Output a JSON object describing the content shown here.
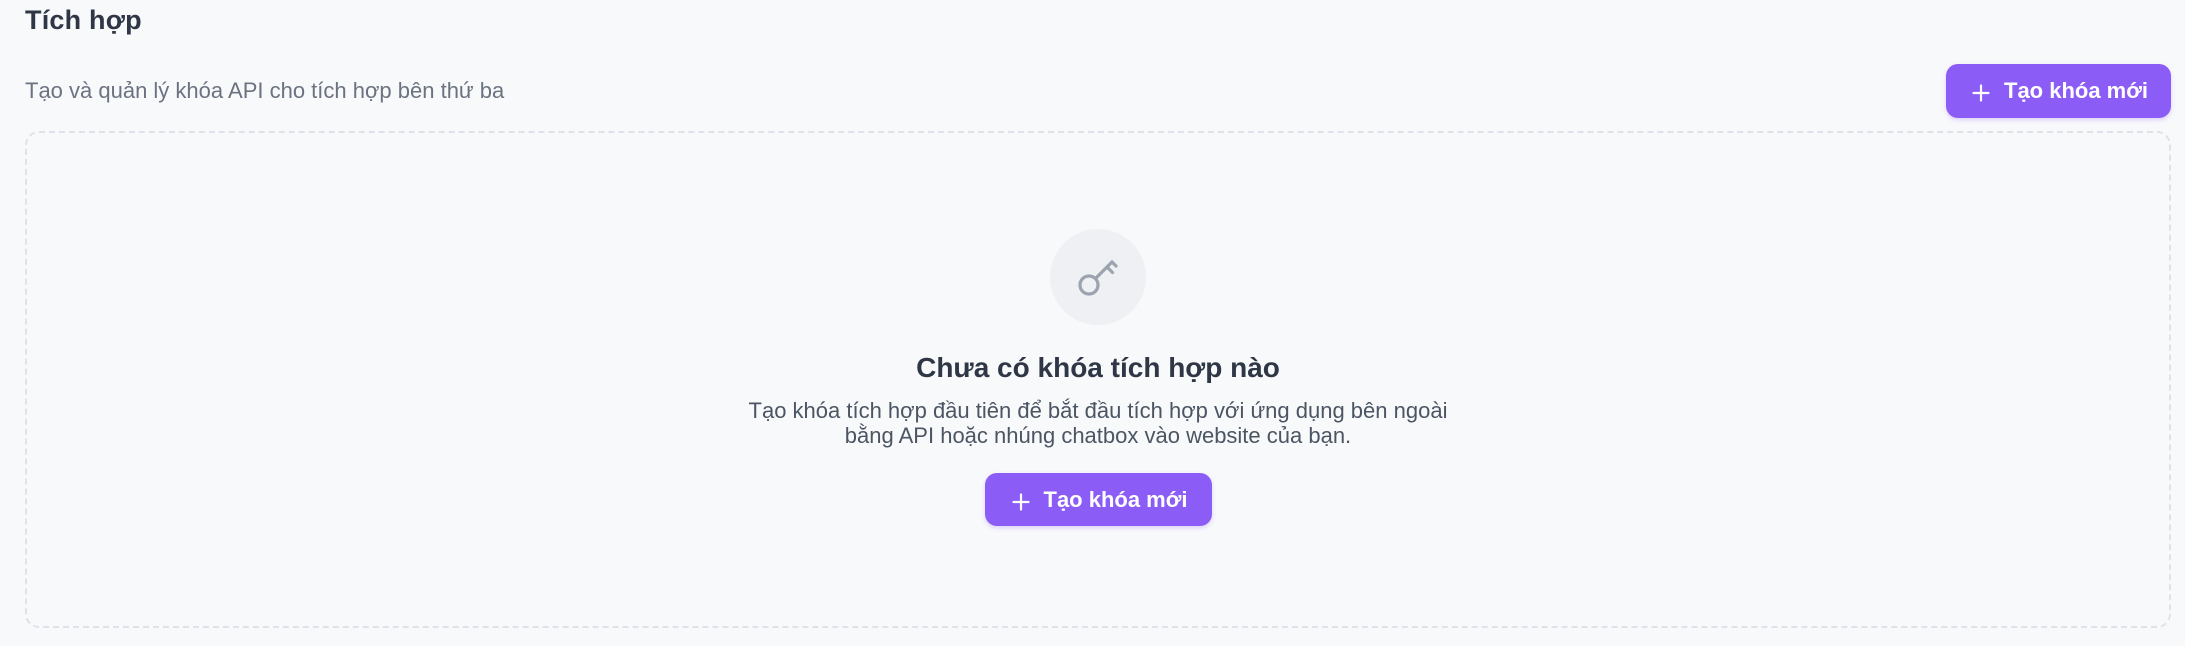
{
  "page": {
    "title": "Tích hợp",
    "subtitle": "Tạo và quản lý khóa API cho tích hợp bên thứ ba"
  },
  "actions": {
    "create_key_label": "Tạo khóa mới",
    "create_key_icon": "plus-icon"
  },
  "empty_state": {
    "icon": "key-icon",
    "title": "Chưa có khóa tích hợp nào",
    "description": "Tạo khóa tích hợp đầu tiên để bắt đầu tích hợp với ứng dụng bên ngoài bằng API hoặc nhúng chatbox vào website của bạn.",
    "button_label": "Tạo khóa mới",
    "button_icon": "plus-icon"
  },
  "colors": {
    "accent": "#8b5cf6",
    "background": "#f8f9fb",
    "title_text": "#2f3746",
    "muted_text": "#6b7280",
    "icon_gray": "#9ca3af",
    "dashed_border": "#dfe3e9"
  }
}
